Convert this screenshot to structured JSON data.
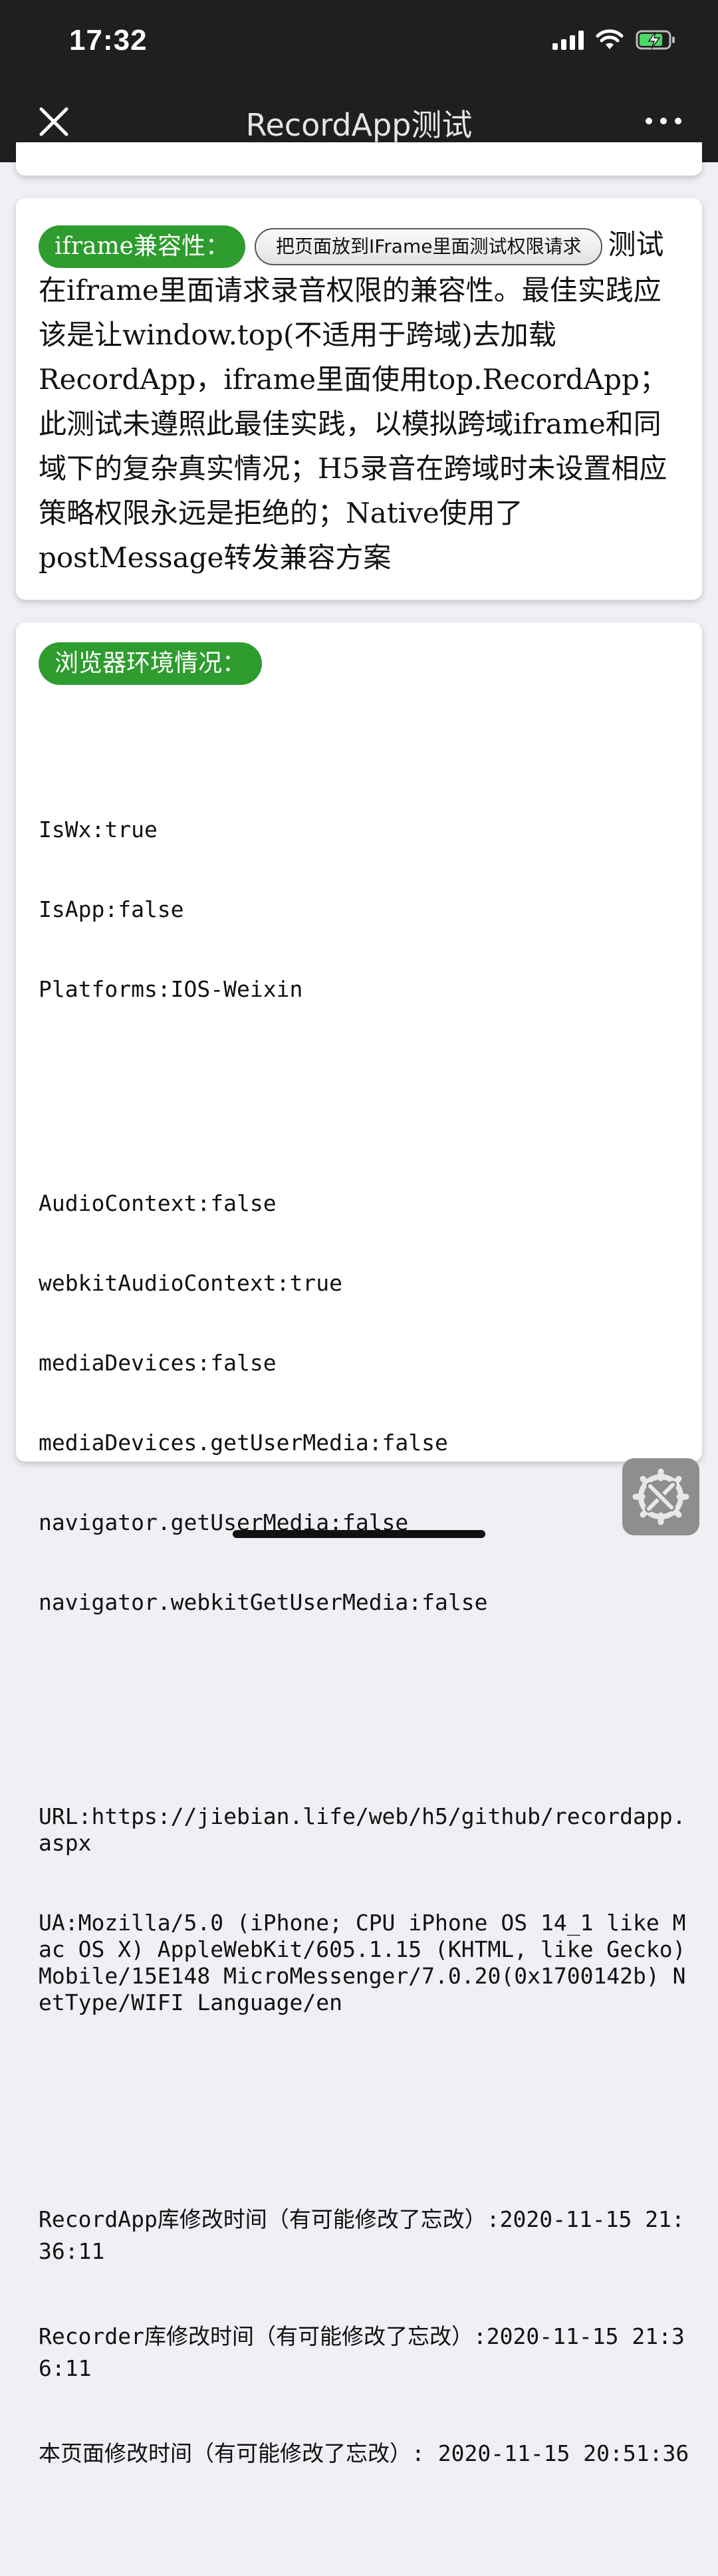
{
  "status": {
    "time": "17:32"
  },
  "nav": {
    "title": "RecordApp测试",
    "close_icon": "close-icon",
    "more_icon": "more-dots-icon"
  },
  "iframe_card": {
    "label": "iframe兼容性：",
    "button_label": "把页面放到IFrame里面测试权限请求",
    "text": "测试在iframe里面请求录音权限的兼容性。最佳实践应该是让window.top(不适用于跨域)去加载RecordApp，iframe里面使用top.RecordApp；此测试未遵照此最佳实践，以模拟跨域iframe和同域下的复杂真实情况；H5录音在跨域时未设置相应策略权限永远是拒绝的；Native使用了postMessage转发兼容方案"
  },
  "env_card": {
    "label": "浏览器环境情况：",
    "group1": [
      "IsWx:true",
      "IsApp:false",
      "Platforms:IOS-Weixin"
    ],
    "group2": [
      "AudioContext:false",
      "webkitAudioContext:true",
      "mediaDevices:false",
      "mediaDevices.getUserMedia:false",
      "navigator.getUserMedia:false",
      "navigator.webkitGetUserMedia:false"
    ],
    "url": "URL:https://jiebian.life/web/h5/github/recordapp.aspx",
    "ua": "UA:Mozilla/5.0 (iPhone; CPU iPhone OS 14_1 like Mac OS X) AppleWebKit/605.1.15 (KHTML, like Gecko) Mobile/15E148 MicroMessenger/7.0.20(0x1700142b) NetType/WIFI Language/en",
    "time1": "RecordApp库修改时间（有可能修改了忘改）:2020-11-15 21:36:11",
    "time2": "Recorder库修改时间（有可能修改了忘改）:2020-11-15 21:36:11",
    "time3": "本页面修改时间（有可能修改了忘改）: 2020-11-15 20:51:36"
  },
  "floating": {
    "tool_icon": "wrench-screwdriver-icon"
  }
}
